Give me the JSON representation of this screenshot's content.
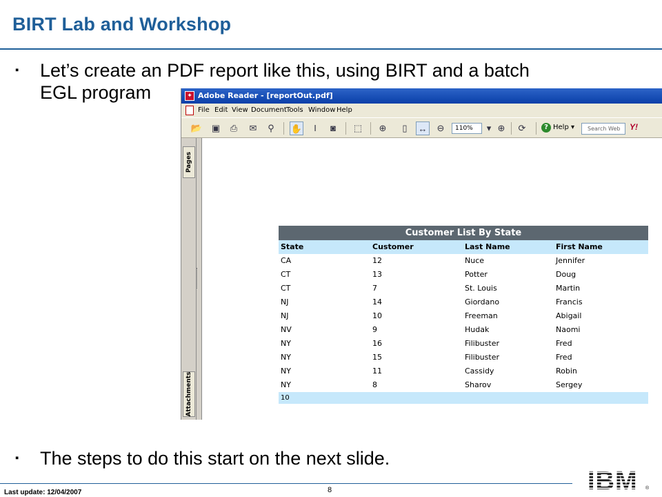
{
  "slide": {
    "title": "BIRT Lab and Workshop",
    "bullet_1": "Let’s create an PDF report like this, using BIRT and a batch EGL program",
    "bullet_2": "The steps to do this start on the next slide.",
    "bullet_marker": "▪",
    "footer_date": "Last update: 12/04/2007",
    "page_number": "8",
    "logo_text": "IBM",
    "colors": {
      "title": "#1f5f99",
      "rule": "#1f5f99"
    }
  },
  "reader": {
    "title": "Adobe Reader - [reportOut.pdf]",
    "menu": [
      "File",
      "Edit",
      "View",
      "Document",
      "Tools",
      "Window",
      "Help"
    ],
    "zoom": "110%",
    "help_label": "Help",
    "search_placeholder": "Search Web",
    "yahoo_label": "Y!",
    "side_tabs": {
      "pages": "Pages",
      "attachments": "Attachments"
    },
    "icons": [
      "open-icon",
      "save-icon",
      "print-icon",
      "email-icon",
      "search-icon",
      "hand-tool-icon",
      "select-text-icon",
      "snapshot-icon",
      "crop-icon",
      "zoom-in-tool-icon",
      "fit-page-icon",
      "fit-width-icon",
      "zoom-out-icon",
      "zoom-in-icon",
      "rotate-icon",
      "help-icon"
    ]
  },
  "report": {
    "title": "Customer List By State",
    "columns": [
      "State",
      "Customer",
      "Last Name",
      "First Name"
    ],
    "rows": [
      [
        "CA",
        "12",
        "Nuce",
        "Jennifer"
      ],
      [
        "CT",
        "13",
        "Potter",
        "Doug"
      ],
      [
        "CT",
        "7",
        "St. Louis",
        "Martin"
      ],
      [
        "NJ",
        "14",
        "Giordano",
        "Francis"
      ],
      [
        "NJ",
        "10",
        "Freeman",
        "Abigail"
      ],
      [
        "NV",
        "9",
        "Hudak",
        "Naomi"
      ],
      [
        "NY",
        "16",
        "Filibuster",
        "Fred"
      ],
      [
        "NY",
        "15",
        "Filibuster",
        "Fred"
      ],
      [
        "NY",
        "11",
        "Cassidy",
        "Robin"
      ],
      [
        "NY",
        "8",
        "Sharov",
        "Sergey"
      ]
    ],
    "footer": "10",
    "colors": {
      "title_bg": "#5c6770",
      "header_bg": "#c6e8fb"
    }
  }
}
